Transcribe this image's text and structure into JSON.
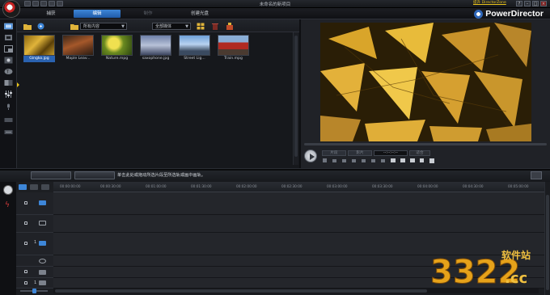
{
  "window": {
    "title": "未命名的新项目"
  },
  "modes": {
    "capture": "捕获",
    "edit": "编辑",
    "produce": "制作",
    "create_disc": "创建光盘"
  },
  "brand": {
    "name": "PowerDirector",
    "upgrade_link": "提升 DirectorZone"
  },
  "library": {
    "folder_combo": "所有内容",
    "filter_combo": "全部媒体",
    "items": [
      {
        "name": "Gingko.jpg",
        "selected": true
      },
      {
        "name": "Maple Leav...",
        "selected": false
      },
      {
        "name": "Nature.mpg",
        "selected": false
      },
      {
        "name": "saxophone.jpg",
        "selected": false
      },
      {
        "name": "Street Lig...",
        "selected": false
      },
      {
        "name": "Train.mpg",
        "selected": false
      }
    ]
  },
  "preview": {
    "mode_clip": "片段",
    "mode_movie": "影片",
    "timecode": "--:--:--:--",
    "zoom": "适合"
  },
  "timeline": {
    "hint": "单击此处或拖动所选片段至所选轨或画中画轨。",
    "ruler": [
      "00:00:00:00",
      "00:00:30:00",
      "00:01:00:00",
      "00:01:30:00",
      "00:02:00:00",
      "00:02:30:00",
      "00:03:00:00",
      "00:03:30:00",
      "00:04:00:00",
      "00:04:30:00",
      "00:05:00:00"
    ],
    "track_1_label": "1",
    "track_fx_label": "1"
  },
  "colors": {
    "accent": "#2a62b0",
    "selection_arrow": "#e8c21a"
  }
}
